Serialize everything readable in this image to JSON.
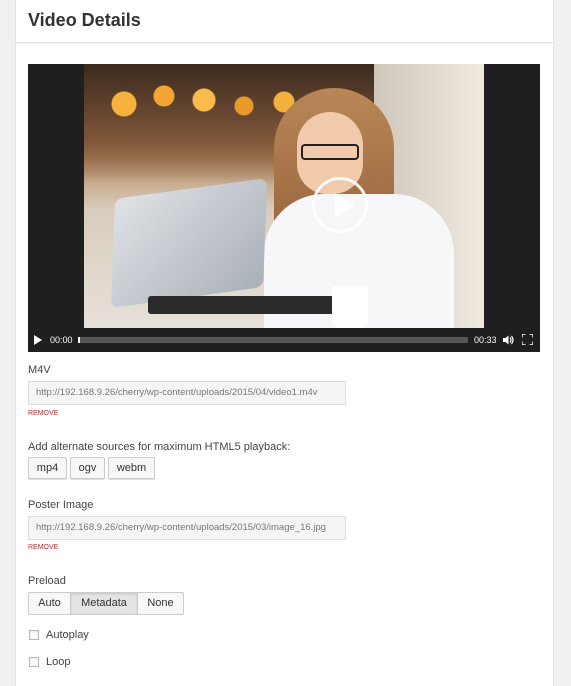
{
  "header": {
    "title": "Video Details"
  },
  "player": {
    "current_time": "00:00",
    "duration": "00:33",
    "progress": 0.0,
    "icons": [
      "play-icon",
      "volume-icon",
      "fullscreen-icon"
    ]
  },
  "m4v": {
    "label": "M4V",
    "value": "http://192.168.9.26/cherry/wp-content/uploads/2015/04/video1.m4v",
    "remove": "REMOVE"
  },
  "alternates": {
    "label": "Add alternate sources for maximum HTML5 playback:",
    "buttons": [
      "mp4",
      "ogv",
      "webm"
    ]
  },
  "poster": {
    "label": "Poster Image",
    "value": "http://192.168.9.26/cherry/wp-content/uploads/2015/03/image_16.jpg",
    "remove": "REMOVE"
  },
  "preload": {
    "label": "Preload",
    "options": [
      "Auto",
      "Metadata",
      "None"
    ],
    "selected": "Metadata"
  },
  "options": {
    "autoplay": {
      "label": "Autoplay",
      "checked": false
    },
    "loop": {
      "label": "Loop",
      "checked": false
    }
  },
  "colors": {
    "remove_link": "#b32d2e",
    "player_bg": "#1f1f1f"
  }
}
